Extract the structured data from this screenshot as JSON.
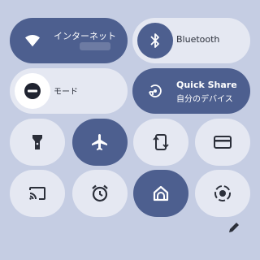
{
  "tiles": {
    "internet": {
      "label": "インターネット",
      "icon": "wifi-icon",
      "active": true
    },
    "bluetooth": {
      "label": "Bluetooth",
      "icon": "bluetooth-icon",
      "active": false
    },
    "mode": {
      "label": "モード",
      "icon": "do-not-disturb-icon",
      "active": false
    },
    "quickshare": {
      "label": "Quick Share",
      "sublabel": "自分のデバイス",
      "icon": "quick-share-icon",
      "active": true
    },
    "flashlight": {
      "icon": "flashlight-icon",
      "active": false
    },
    "airplane": {
      "icon": "airplane-icon",
      "active": true
    },
    "autorotate": {
      "icon": "auto-rotate-icon",
      "active": false
    },
    "wallet": {
      "icon": "wallet-icon",
      "active": false
    },
    "cast": {
      "icon": "cast-icon",
      "active": false
    },
    "alarm": {
      "icon": "alarm-icon",
      "active": false
    },
    "home": {
      "icon": "home-icon",
      "active": true
    },
    "screenrecord": {
      "icon": "screen-record-icon",
      "active": false
    }
  },
  "footer": {
    "edit_icon": "pencil-icon"
  },
  "colors": {
    "background": "#c5cde3",
    "tile_on": "#4d5f8f",
    "tile_off": "#e5e8f2",
    "text_dark": "#2b2f3a"
  }
}
